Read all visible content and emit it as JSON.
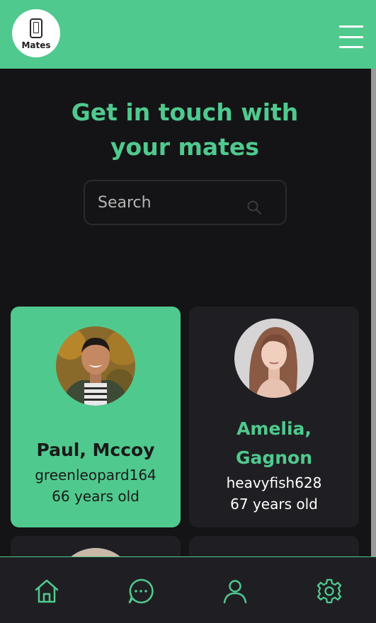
{
  "header": {
    "logo_label": "Mates"
  },
  "hero": {
    "headline": "Get in touch with your mates"
  },
  "search": {
    "placeholder": "Search"
  },
  "mates": [
    {
      "name": "Paul, Mccoy",
      "username": "greenleopard164",
      "age": "66 years old"
    },
    {
      "name": "Amelia, Gagnon",
      "username": "heavyfish628",
      "age": "67 years old"
    }
  ],
  "bottom_nav": {
    "items": [
      {
        "icon": "home-icon"
      },
      {
        "icon": "chat-icon"
      },
      {
        "icon": "user-icon"
      },
      {
        "icon": "settings-icon"
      }
    ]
  },
  "colors": {
    "accent": "#50c98e",
    "background": "#141416",
    "card_dark": "#1f1f23"
  }
}
